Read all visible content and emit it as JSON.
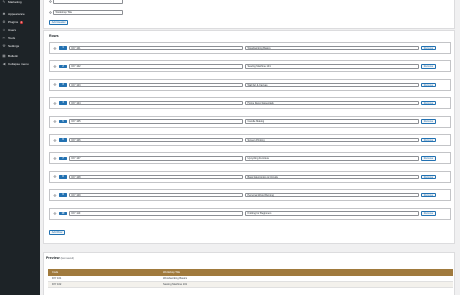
{
  "sidebar": {
    "items": [
      {
        "icon": "megaphone-icon",
        "glyph": "✎",
        "label": "Marketing"
      },
      {
        "icon": "appearance-icon",
        "glyph": "✱",
        "label": "Appearance"
      },
      {
        "icon": "plugins-icon",
        "glyph": "⚙",
        "label": "Plugins",
        "badge": "1"
      },
      {
        "icon": "users-icon",
        "glyph": "☺",
        "label": "Users"
      },
      {
        "icon": "tools-icon",
        "glyph": "✂",
        "label": "Tools"
      },
      {
        "icon": "settings-icon",
        "glyph": "⚒",
        "label": "Settings"
      },
      {
        "icon": "bulletin-icon",
        "glyph": "▦",
        "label": "Bulletin"
      },
      {
        "icon": "collapse-icon",
        "glyph": "◀",
        "label": "Collapse menu"
      }
    ]
  },
  "top_panel": {
    "workshop_title_value": "Workshop Title",
    "add_header_label": "Add Header"
  },
  "rows": {
    "title": "Rows",
    "code_placeholder": "",
    "remove_label": "Remove",
    "add_row_label": "Add Row",
    "items": [
      {
        "num": "1",
        "code": "DIY 101",
        "title": "Woodworking Basics"
      },
      {
        "num": "2",
        "code": "DIY 102",
        "title": "Sewing Machine 101"
      },
      {
        "num": "3",
        "code": "DIY 103",
        "title": "Wall Art & Canvas"
      },
      {
        "num": "4",
        "code": "DIY 104",
        "title": "Home Decor Essentials"
      },
      {
        "num": "5",
        "code": "DIY 105",
        "title": "Candle Making"
      },
      {
        "num": "6",
        "code": "DIY 106",
        "title": "Screen Printing"
      },
      {
        "num": "7",
        "code": "DIY 107",
        "title": "Upcycling Furniture"
      },
      {
        "num": "8",
        "code": "DIY 108",
        "title": "Basic Electronics & Circuits"
      },
      {
        "num": "9",
        "code": "DIY 109",
        "title": "Personal Wood Burning"
      },
      {
        "num": "10",
        "code": "DIY 110",
        "title": "Knitting for Beginners"
      }
    ]
  },
  "preview": {
    "title": "Preview",
    "subtitle": "(last saved)",
    "col_code": "Code",
    "col_title": "Workshop Title",
    "rows": [
      {
        "code": "DIY 101",
        "title": "Woodworking Basics"
      },
      {
        "code": "DIY 102",
        "title": "Sewing Machine 101"
      }
    ]
  }
}
